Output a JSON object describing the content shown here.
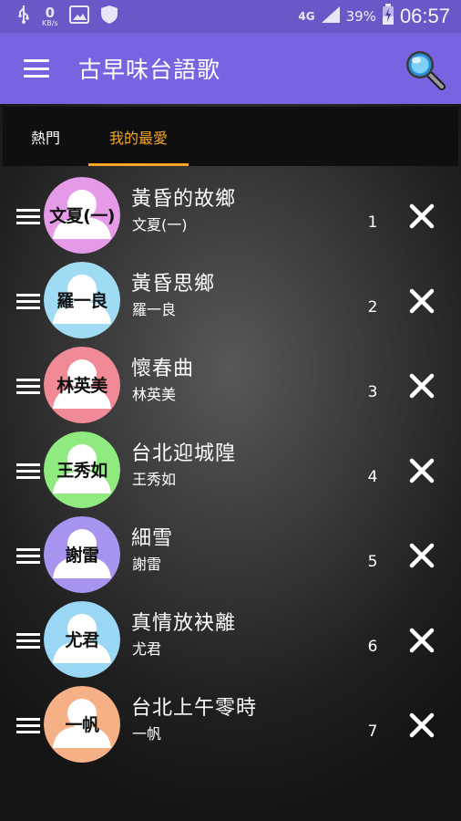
{
  "status_bar": {
    "net_speed_value": "0",
    "net_speed_unit": "KB/s",
    "network": "4G",
    "battery_percent": "39%",
    "time": "06:57"
  },
  "app_bar": {
    "title": "古早味台語歌",
    "menu_icon": "hamburger-menu-icon",
    "search_icon": "magnifier-icon"
  },
  "tabs": [
    {
      "label": "熱門",
      "active": false
    },
    {
      "label": "我的最愛",
      "active": true
    }
  ],
  "colors": {
    "status_bar": "#6a58c8",
    "app_bar": "#7a63e0",
    "tab_active": "#f5a623"
  },
  "songs": [
    {
      "title": "黃昏的故鄉",
      "artist": "文夏(一)",
      "avatar_label": "文夏(一)",
      "number": "1",
      "avatar_color": "#e49ae6"
    },
    {
      "title": "黃昏思鄉",
      "artist": "羅一良",
      "avatar_label": "羅一良",
      "number": "2",
      "avatar_color": "#9fdcf3"
    },
    {
      "title": "懷春曲",
      "artist": "林英美",
      "avatar_label": "林英美",
      "number": "3",
      "avatar_color": "#ef8a96"
    },
    {
      "title": "台北迎城隍",
      "artist": "王秀如",
      "avatar_label": "王秀如",
      "number": "4",
      "avatar_color": "#8feb80"
    },
    {
      "title": "細雪",
      "artist": "謝雷",
      "avatar_label": "謝雷",
      "number": "5",
      "avatar_color": "#a894ee"
    },
    {
      "title": "真情放袂離",
      "artist": "尤君",
      "avatar_label": "尤君",
      "number": "6",
      "avatar_color": "#99d7f5"
    },
    {
      "title": "台北上午零時",
      "artist": "一帆",
      "avatar_label": "一帆",
      "number": "7",
      "avatar_color": "#f6b086"
    }
  ]
}
